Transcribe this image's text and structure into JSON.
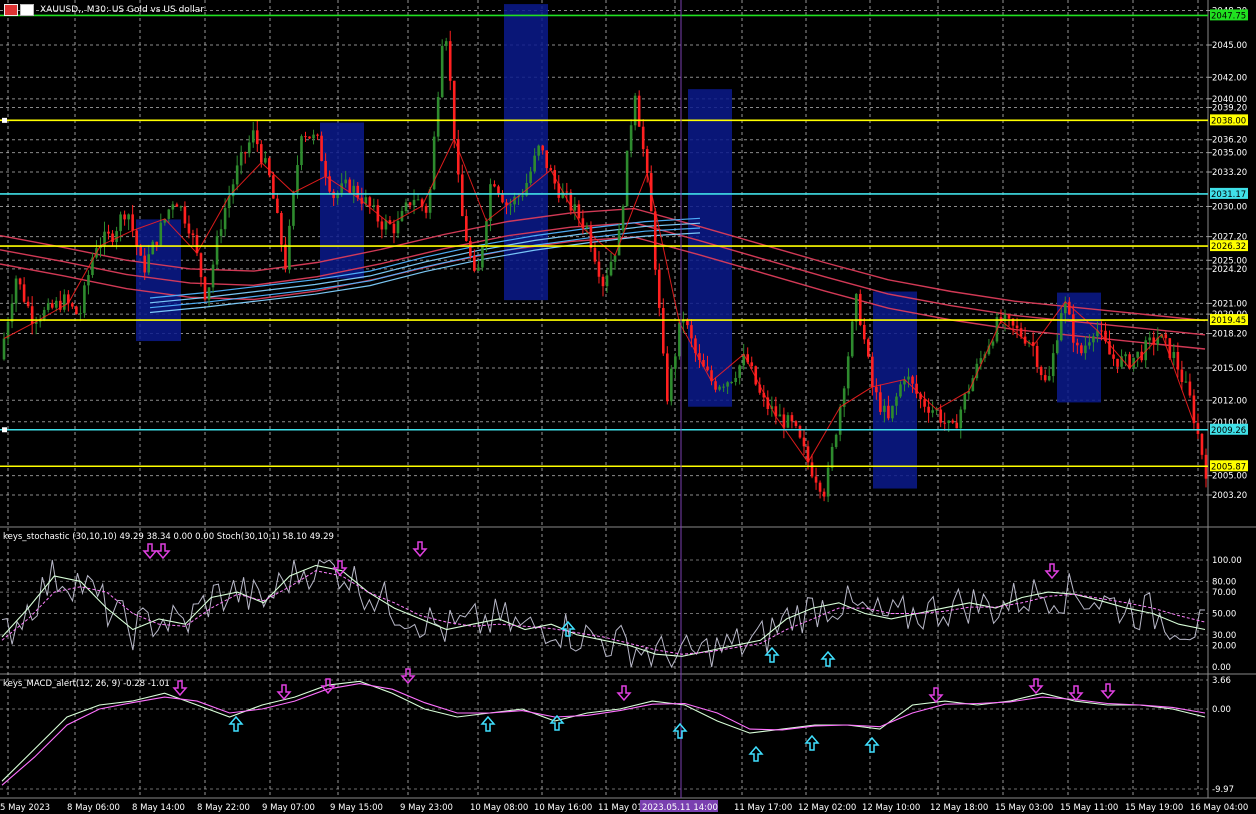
{
  "window": {
    "symbol_title": "XAUUSD,, M30:  US Gold vs US dollar"
  },
  "panes": {
    "stochastic_label": "keys_stochastic (30,10,10) 49.29 38.34 0.00 0.00 Stoch(30,10,1) 58.10 49.29",
    "macd_label": "keys_MACD_alert(12, 26, 9) -0.28 -1.01"
  },
  "colors": {
    "background": "#000000",
    "grid": "#c8c8c8",
    "bull_candle": "#2e8b2e",
    "bear_candle": "#ff2020",
    "support_yellow": "#ffff00",
    "support_cyan": "#40e0e8",
    "top_green_line": "#20e020",
    "box_navy": "#0a1a8c",
    "cursor_line": "#7a3fb0",
    "ma_red": "#dc3c5a",
    "ma_blue": "#50b4ff",
    "arrow_up": "#40e0ff",
    "arrow_down": "#e040e0"
  },
  "chart_data": [
    {
      "type": "line",
      "title": "XAUUSD,, M30:  US Gold vs US dollar",
      "ylim": [
        2001.2,
        2049.5
      ],
      "x": [
        "5 May 2023",
        "8 May 06:00",
        "8 May 14:00",
        "8 May 22:00",
        "9 May 07:00",
        "9 May 15:00",
        "9 May 23:00",
        "10 May 08:00",
        "10 May 16:00",
        "11 May 01:00",
        "2023.05.11 14:00",
        "11 May 17:00",
        "12 May 02:00",
        "12 May 10:00",
        "12 May 18:00",
        "15 May 03:00",
        "15 May 11:00",
        "15 May 19:00",
        "16 May 04:00"
      ],
      "price_path": [
        2015.8,
        2023.5,
        2019.8,
        2020.2,
        2021.3,
        2019.8,
        2026.5,
        2027.2,
        2030.0,
        2024.0,
        2027.5,
        2031.0,
        2028.0,
        2021.5,
        2029.0,
        2033.6,
        2036.8,
        2032.5,
        2024.5,
        2037.2,
        2036.0,
        2031.0,
        2032.0,
        2030.5,
        2028.5,
        2028.0,
        2031.0,
        2029.5,
        2048.2,
        2030.0,
        2022.5,
        2033.0,
        2030.0,
        2031.5,
        2035.5,
        2032.0,
        2030.0,
        2028.0,
        2023.0,
        2027.0,
        2041.2,
        2030.0,
        2012.0,
        2020.0,
        2015.5,
        2013.5,
        2014.0,
        2016.0,
        2012.0,
        2010.5,
        2009.5,
        2006.0,
        2003.5,
        2012.0,
        2021.5,
        2013.0,
        2010.0,
        2014.5,
        2012.0,
        2011.0,
        2009.0,
        2013.0,
        2016.5,
        2019.5,
        2018.5,
        2017.5,
        2013.0,
        2021.5,
        2016.0,
        2019.0,
        2016.0,
        2015.5,
        2016.5,
        2018.0,
        2016.0,
        2012.0,
        2005.5
      ],
      "y_ticks": [
        2003.2,
        2005.0,
        2010.0,
        2012.0,
        2015.0,
        2018.2,
        2020.0,
        2021.0,
        2024.2,
        2025.0,
        2027.2,
        2030.0,
        2033.2,
        2035.0,
        2036.2,
        2039.2,
        2040.0,
        2042.0,
        2045.0,
        2048.2
      ],
      "y_tick_labels": [
        "2003.20",
        "2005.00",
        "2010.00",
        "2012.00",
        "2015.00",
        "2018.20",
        "2020.00",
        "2021.00",
        "2024.20",
        "2025.00",
        "2027.20",
        "2030.00",
        "2033.20",
        "2035.00",
        "2036.20",
        "2039.20",
        "2040.00",
        "2042.00",
        "2045.00",
        "2048.20"
      ],
      "horizontal_levels": [
        {
          "value": 2047.75,
          "label": "2047.75",
          "color": "#20e020"
        },
        {
          "value": 2038.0,
          "label": "2038.00",
          "color": "#ffff00"
        },
        {
          "value": 2031.17,
          "label": "2031.17",
          "color": "#40e0e8"
        },
        {
          "value": 2026.32,
          "label": "2026.32",
          "color": "#ffff00"
        },
        {
          "value": 2019.45,
          "label": "2019.45",
          "color": "#ffff00"
        },
        {
          "value": 2009.26,
          "label": "2009.26",
          "color": "#40e0e8"
        },
        {
          "value": 2005.87,
          "label": "2005.87",
          "color": "#ffff00"
        }
      ],
      "ma_red": [
        2026.3,
        2025.2,
        2024.0,
        2023.2,
        2023.0,
        2023.8,
        2025.0,
        2026.4,
        2027.6,
        2028.4,
        2028.8,
        2027.2,
        2025.5,
        2023.8,
        2022.2,
        2021.1,
        2020.2,
        2019.6,
        2019.0,
        2018.4
      ],
      "ma_blue": [
        2021.5,
        2022.0,
        2022.6,
        2023.2,
        2024.0,
        2025.3,
        2026.4,
        2027.3,
        2028.0,
        2028.6,
        2028.9
      ],
      "zones": [
        {
          "top": 2028.8,
          "bottom": 2017.5
        },
        {
          "top": 2037.8,
          "bottom": 2023.3
        },
        {
          "top": 2048.8,
          "bottom": 2021.3
        },
        {
          "top": 2040.9,
          "bottom": 2011.4
        },
        {
          "top": 2022.1,
          "bottom": 2003.8
        },
        {
          "top": 2022.0,
          "bottom": 2011.8
        }
      ]
    },
    {
      "type": "line",
      "title": "keys_stochastic (30,10,10) 49.29 38.34 0.00 0.00 Stoch(30,10,1) 58.10 49.29",
      "ylim": [
        0,
        100
      ],
      "y_ticks": [
        0,
        20,
        30,
        50,
        70,
        80,
        100
      ],
      "y_tick_labels": [
        "0.00",
        "20.00",
        "30.00",
        "50.00",
        "70.00",
        "80.00",
        "100.00"
      ],
      "series": [
        {
          "name": "",
          "values": [
            28,
            55,
            85,
            80,
            55,
            35,
            45,
            40,
            65,
            70,
            60,
            85,
            95,
            90,
            70,
            55,
            45,
            35,
            40,
            45,
            35,
            40,
            30,
            25,
            20,
            12,
            10,
            15,
            20,
            25,
            45,
            55,
            60,
            50,
            45,
            50,
            55,
            60,
            55,
            65,
            70,
            68,
            62,
            55,
            50,
            40,
            35
          ]
        },
        {
          "name": "",
          "values": [
            25,
            45,
            70,
            75,
            70,
            50,
            40,
            38,
            55,
            68,
            62,
            75,
            90,
            85,
            70,
            60,
            48,
            42,
            38,
            40,
            38,
            36,
            32,
            28,
            22,
            16,
            12,
            14,
            18,
            22,
            35,
            45,
            55,
            55,
            50,
            50,
            52,
            56,
            56,
            60,
            66,
            68,
            64,
            60,
            55,
            48,
            42
          ]
        }
      ]
    },
    {
      "type": "line",
      "title": "keys_MACD_alert(12, 26, 9) -0.28 -1.01",
      "ylim": [
        -9.97,
        3.66
      ],
      "y_ticks": [
        3.66,
        0,
        -9.97
      ],
      "y_tick_labels": [
        "3.66",
        "0.00",
        "-9.97"
      ],
      "series": [
        {
          "name": "",
          "values": [
            -9.0,
            -5.0,
            -1.0,
            0.5,
            1.0,
            2.0,
            0.5,
            -1.0,
            0.5,
            1.5,
            3.0,
            3.5,
            2.0,
            0.0,
            -1.0,
            -0.5,
            0.0,
            -1.5,
            -0.5,
            0.0,
            1.0,
            0.5,
            -1.5,
            -3.0,
            -2.5,
            -2.0,
            -2.0,
            -2.5,
            0.5,
            1.0,
            0.5,
            1.0,
            2.0,
            1.0,
            0.5,
            0.5,
            0.0,
            -1.0
          ]
        },
        {
          "name": "",
          "values": [
            -9.5,
            -6.0,
            -2.0,
            0.0,
            0.8,
            1.5,
            1.0,
            -0.5,
            0.0,
            1.0,
            2.5,
            3.2,
            2.5,
            0.8,
            -0.5,
            -0.5,
            -0.2,
            -1.0,
            -0.8,
            -0.2,
            0.6,
            0.7,
            -0.5,
            -2.5,
            -2.6,
            -2.1,
            -2.0,
            -2.2,
            -0.5,
            0.6,
            0.7,
            0.9,
            1.5,
            1.2,
            0.7,
            0.5,
            0.2,
            -0.5
          ]
        }
      ]
    }
  ],
  "time_axis": {
    "labels": [
      "5 May 2023",
      "8 May 06:00",
      "8 May 14:00",
      "8 May 22:00",
      "9 May 07:00",
      "9 May 15:00",
      "9 May 23:00",
      "10 May 08:00",
      "10 May 16:00",
      "11 May 01:00",
      "2023.05.11 14:00",
      "11 May 17:00",
      "12 May 02:00",
      "12 May 10:00",
      "12 May 18:00",
      "15 May 03:00",
      "15 May 11:00",
      "15 May 19:00",
      "16 May 04:00"
    ],
    "highlighted_label": "2023.05.11 14:00"
  }
}
